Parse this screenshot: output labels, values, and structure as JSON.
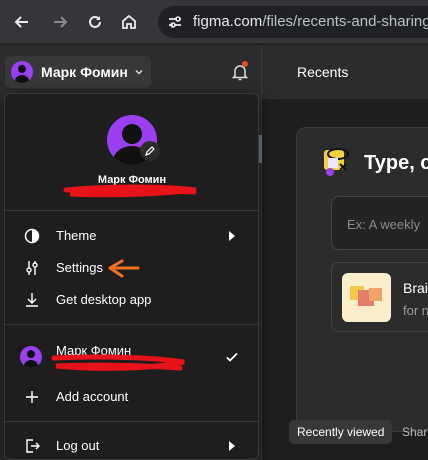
{
  "browser": {
    "url_host": "figma.com",
    "url_path": "/files/recents-and-sharing/r"
  },
  "app_bar": {
    "account_name": "Марк Фомин",
    "recents_tab": "Recents",
    "notification_dot_color": "#f24822"
  },
  "account_menu": {
    "profile_name": "Марк Фомин",
    "items": [
      {
        "label": "Theme",
        "icon": "theme-icon",
        "submenu": true
      },
      {
        "label": "Settings",
        "icon": "sliders-icon"
      },
      {
        "label": "Get desktop app",
        "icon": "download-icon"
      }
    ],
    "accounts": [
      {
        "name": "Марк Фомин",
        "selected": true
      }
    ],
    "add_account": "Add account",
    "logout": "Log out",
    "avatar_color": "#9b3ff2"
  },
  "main": {
    "prompt_title": "Type, c",
    "prompt_placeholder": "Ex: A weekly",
    "template_title": "Brai",
    "template_subtitle": "for n",
    "filters": {
      "recently_viewed": "Recently viewed",
      "shared": "Share"
    }
  },
  "annotations": {
    "redaction_color": "#e8121b",
    "arrow_color": "#f26f21"
  }
}
